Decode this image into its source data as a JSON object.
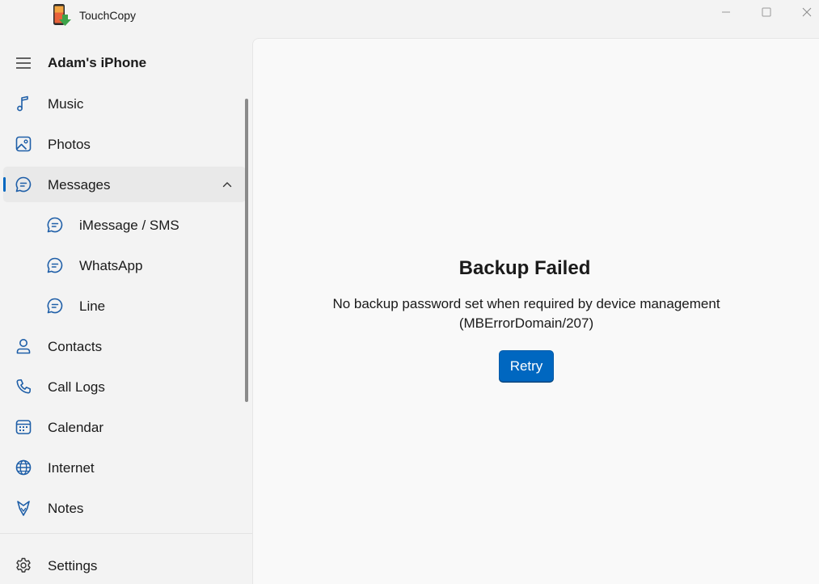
{
  "window": {
    "app_title": "TouchCopy",
    "controls": {
      "minimize_icon": "minimize-icon",
      "maximize_icon": "maximize-icon",
      "close_icon": "close-icon"
    }
  },
  "sidebar": {
    "device_name": "Adam's iPhone",
    "menu_icon": "hamburger-icon",
    "items": [
      {
        "label": "Music",
        "icon": "music-note-icon"
      },
      {
        "label": "Photos",
        "icon": "photo-icon"
      },
      {
        "label": "Messages",
        "icon": "chat-bubble-icon",
        "expanded": true,
        "selected": true,
        "children": [
          {
            "label": "iMessage / SMS",
            "icon": "chat-bubble-icon"
          },
          {
            "label": "WhatsApp",
            "icon": "chat-bubble-icon"
          },
          {
            "label": "Line",
            "icon": "chat-bubble-icon"
          }
        ]
      },
      {
        "label": "Contacts",
        "icon": "person-icon"
      },
      {
        "label": "Call Logs",
        "icon": "phone-icon"
      },
      {
        "label": "Calendar",
        "icon": "calendar-icon"
      },
      {
        "label": "Internet",
        "icon": "globe-icon"
      },
      {
        "label": "Notes",
        "icon": "notes-icon"
      }
    ],
    "settings": {
      "label": "Settings",
      "icon": "gear-icon"
    }
  },
  "main": {
    "error_title": "Backup Failed",
    "error_message_line1": "No backup password set when required by device management",
    "error_message_line2": "(MBErrorDomain/207)",
    "retry_label": "Retry"
  },
  "colors": {
    "accent": "#0067c0",
    "sidebar_bg": "#f3f3f3",
    "content_bg": "#f9f9f9",
    "selected_bg": "#e9e9e9"
  }
}
